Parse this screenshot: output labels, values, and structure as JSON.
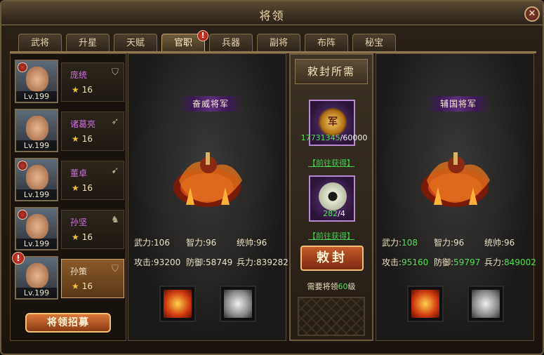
{
  "window": {
    "title": "将领",
    "close_icon": "close-icon"
  },
  "tabs": [
    {
      "label": "武将",
      "active": false,
      "badge": ""
    },
    {
      "label": "升星",
      "active": false,
      "badge": ""
    },
    {
      "label": "天赋",
      "active": false,
      "badge": ""
    },
    {
      "label": "官职",
      "active": true,
      "badge": "!"
    },
    {
      "label": "兵器",
      "active": false,
      "badge": ""
    },
    {
      "label": "副将",
      "active": false,
      "badge": ""
    },
    {
      "label": "布阵",
      "active": false,
      "badge": ""
    },
    {
      "label": "秘宝",
      "active": false,
      "badge": ""
    }
  ],
  "heroes": [
    {
      "name": "庞统",
      "level": "Lv.199",
      "stars": "16",
      "type_icon": "shield-icon",
      "alert": ""
    },
    {
      "name": "诸葛亮",
      "level": "Lv.199",
      "stars": "16",
      "type_icon": "bow-icon",
      "alert": ""
    },
    {
      "name": "董卓",
      "level": "Lv.199",
      "stars": "16",
      "type_icon": "spear-icon",
      "alert": ""
    },
    {
      "name": "孙坚",
      "level": "Lv.199",
      "stars": "16",
      "type_icon": "cavalry-icon",
      "alert": ""
    },
    {
      "name": "孙策",
      "level": "Lv.199",
      "stars": "16",
      "type_icon": "shield-icon",
      "alert": "!"
    }
  ],
  "recruit_button": "将领招募",
  "current": {
    "rank": "奋威将军",
    "stats": {
      "force_label": "武力:",
      "force": "106",
      "intel_label": "智力:",
      "intel": "96",
      "lead_label": "统帅:",
      "lead": "96",
      "atk_label": "攻击:",
      "atk": "93200",
      "def_label": "防御:",
      "def": "58749",
      "troops_label": "兵力:",
      "troops": "839282"
    }
  },
  "next": {
    "rank": "辅国将军",
    "stats": {
      "force_label": "武力:",
      "force": "108",
      "intel_label": "智力:",
      "intel": "96",
      "lead_label": "统帅:",
      "lead": "96",
      "atk_label": "攻击:",
      "atk": "95160",
      "def_label": "防御:",
      "def": "59797",
      "troops_label": "兵力:",
      "troops": "849002"
    }
  },
  "requirements": {
    "title": "敕封所需",
    "item1": {
      "icon": "coin-icon",
      "glyph": "军",
      "have": "17731345",
      "need": "/60000"
    },
    "item2": {
      "icon": "jade-icon",
      "have": "282",
      "need": "/4"
    },
    "goto_link": "【前往获得】",
    "confer_button": "敕封",
    "note_prefix": "需要将领",
    "note_level": "60",
    "note_suffix": "级"
  },
  "colors": {
    "accent_gold": "#c8a66c",
    "green_value": "#4fe050",
    "name_purple": "#d070e0"
  }
}
